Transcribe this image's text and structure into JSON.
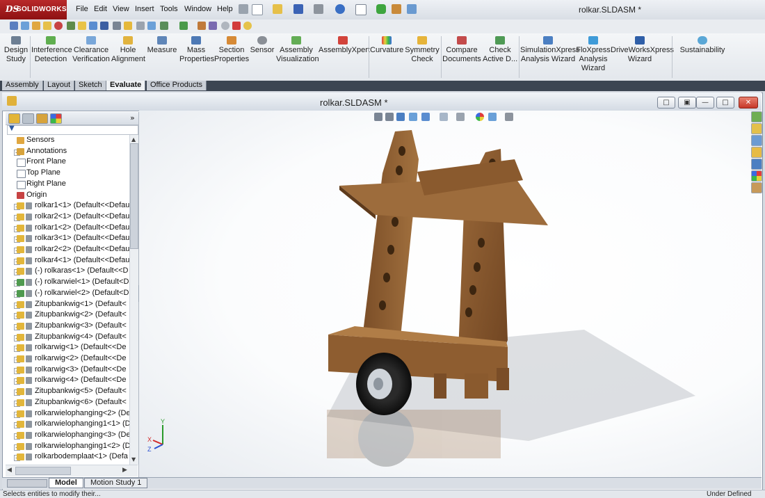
{
  "app": {
    "brand": "SOLIDWORKS",
    "brand_mark": "DS",
    "window_title": "rolkar.SLDASM *"
  },
  "menu": [
    "File",
    "Edit",
    "View",
    "Insert",
    "Tools",
    "Window",
    "Help"
  ],
  "commands": [
    {
      "label": "Design\nStudy",
      "icon": "design-study-icon"
    },
    {
      "label": "Interference\nDetection",
      "icon": "interference-icon"
    },
    {
      "label": "Clearance\nVerification",
      "icon": "clearance-icon"
    },
    {
      "label": "Hole\nAlignment",
      "icon": "hole-alignment-icon"
    },
    {
      "label": "Measure",
      "icon": "measure-icon"
    },
    {
      "label": "Mass\nProperties",
      "icon": "mass-properties-icon"
    },
    {
      "label": "Section\nProperties",
      "icon": "section-properties-icon"
    },
    {
      "label": "Sensor",
      "icon": "sensor-icon"
    },
    {
      "label": "Assembly\nVisualization",
      "icon": "assembly-visualization-icon"
    },
    {
      "label": "AssemblyXpert",
      "icon": "assemblyxpert-icon"
    },
    {
      "label": "Curvature",
      "icon": "curvature-icon"
    },
    {
      "label": "Symmetry\nCheck",
      "icon": "symmetry-icon"
    },
    {
      "label": "Compare\nDocuments",
      "icon": "compare-icon"
    },
    {
      "label": "Check\nActive D...",
      "icon": "check-icon"
    },
    {
      "label": "SimulationXpress\nAnalysis Wizard",
      "icon": "simulation-icon"
    },
    {
      "label": "FloXpress\nAnalysis\nWizard",
      "icon": "floxpress-icon"
    },
    {
      "label": "DriveWorksXpress\nWizard",
      "icon": "driveworks-icon"
    },
    {
      "label": "Sustainability",
      "icon": "sustainability-icon"
    }
  ],
  "tabs": [
    "Assembly",
    "Layout",
    "Sketch",
    "Evaluate",
    "Office Products"
  ],
  "active_tab": "Evaluate",
  "document": {
    "title": "rolkar.SLDASM *"
  },
  "tree": [
    {
      "label": "Sensors",
      "icon": "sensor-folder-icon",
      "expandable": false
    },
    {
      "label": "Annotations",
      "icon": "annotations-icon",
      "expandable": true
    },
    {
      "label": "Front Plane",
      "icon": "plane-icon",
      "expandable": false
    },
    {
      "label": "Top Plane",
      "icon": "plane-icon",
      "expandable": false
    },
    {
      "label": "Right Plane",
      "icon": "plane-icon",
      "expandable": false
    },
    {
      "label": "Origin",
      "icon": "origin-icon",
      "expandable": false
    },
    {
      "label": "rolkar1<1> (Default<<Defau",
      "icon": "part-icon",
      "expandable": true
    },
    {
      "label": "rolkar2<1> (Default<<Defau",
      "icon": "part-icon",
      "expandable": true
    },
    {
      "label": "rolkar1<2> (Default<<Defau",
      "icon": "part-icon",
      "expandable": true
    },
    {
      "label": "rolkar3<1> (Default<<Defau",
      "icon": "part-icon",
      "expandable": true
    },
    {
      "label": "rolkar2<2> (Default<<Defau",
      "icon": "part-icon",
      "expandable": true
    },
    {
      "label": "rolkar4<1> (Default<<Defau",
      "icon": "part-icon",
      "expandable": true
    },
    {
      "label": "(-) rolkaras<1> (Default<<D",
      "icon": "part-icon",
      "expandable": true
    },
    {
      "label": "(-) rolkarwiel<1> (Default<D",
      "icon": "subassembly-icon",
      "expandable": true
    },
    {
      "label": "(-) rolkarwiel<2> (Default<D",
      "icon": "subassembly-icon",
      "expandable": true
    },
    {
      "label": "Zitupbankwig<1> (Default<",
      "icon": "part-icon",
      "expandable": true
    },
    {
      "label": "Zitupbankwig<2> (Default<",
      "icon": "part-icon",
      "expandable": true
    },
    {
      "label": "Zitupbankwig<3> (Default<",
      "icon": "part-icon",
      "expandable": true
    },
    {
      "label": "Zitupbankwig<4> (Default<",
      "icon": "part-icon",
      "expandable": true
    },
    {
      "label": "rolkarwig<1> (Default<<De",
      "icon": "part-icon",
      "expandable": true
    },
    {
      "label": "rolkarwig<2> (Default<<De",
      "icon": "part-icon",
      "expandable": true
    },
    {
      "label": "rolkarwig<3> (Default<<De",
      "icon": "part-icon",
      "expandable": true
    },
    {
      "label": "rolkarwig<4> (Default<<De",
      "icon": "part-icon",
      "expandable": true
    },
    {
      "label": "Zitupbankwig<5> (Default<",
      "icon": "part-icon",
      "expandable": true
    },
    {
      "label": "Zitupbankwig<6> (Default<",
      "icon": "part-icon",
      "expandable": true
    },
    {
      "label": "rolkarwielophanging<2> (De",
      "icon": "part-icon",
      "expandable": true
    },
    {
      "label": "rolkarwielophanging1<1> (D",
      "icon": "part-icon",
      "expandable": true
    },
    {
      "label": "rolkarwielophanging<3> (De",
      "icon": "part-icon",
      "expandable": true
    },
    {
      "label": "rolkarwielophanging1<2> (D",
      "icon": "part-icon",
      "expandable": true
    },
    {
      "label": "rolkarbodemplaat<1> (Defa",
      "icon": "part-icon",
      "expandable": true
    }
  ],
  "bottom_tabs": [
    "Model",
    "Motion Study 1"
  ],
  "status": {
    "left": "Selects entities to modify their...",
    "right": "Under Defined"
  },
  "triad": {
    "y": "Y",
    "x": "X",
    "z": "Z"
  },
  "colors": {
    "brand_red": "#a81c1d",
    "wood": "#8a5a2e",
    "tab_bar": "#3c4552"
  }
}
